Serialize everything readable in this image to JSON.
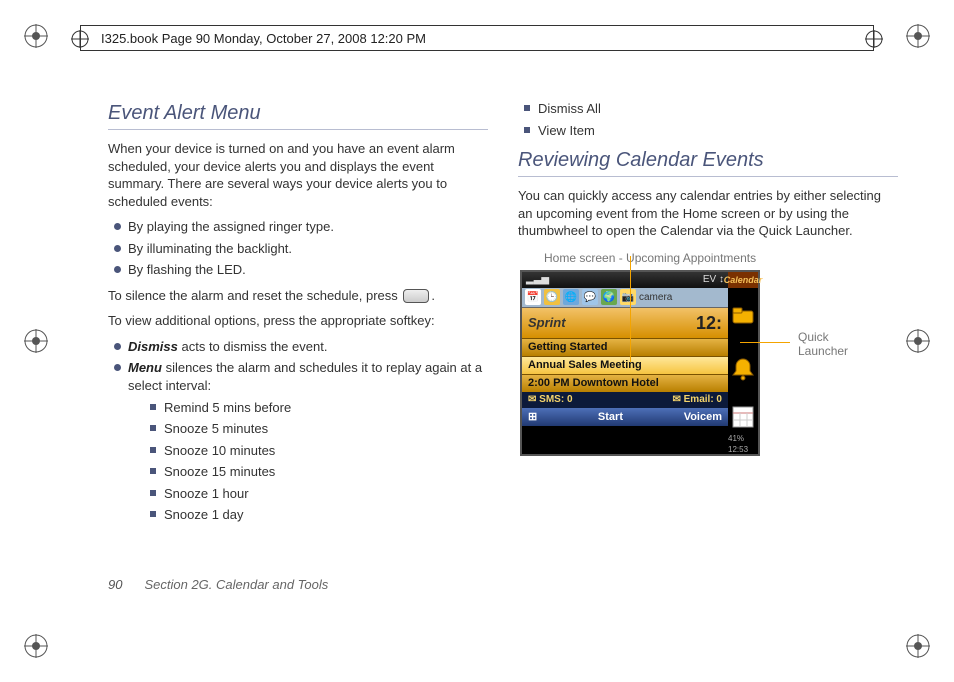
{
  "header": {
    "running": "I325.book  Page 90  Monday, October 27, 2008  12:20 PM"
  },
  "footer": {
    "pagenum": "90",
    "section": "Section 2G. Calendar and Tools"
  },
  "left": {
    "h1": "Event Alert Menu",
    "p1": "When your device is turned on and you have an event alarm scheduled, your device alerts you and displays the event summary. There are several ways your device alerts you to scheduled events:",
    "b1": "By playing the assigned ringer type.",
    "b2": "By illuminating the backlight.",
    "b3": "By flashing the LED.",
    "p2a": "To silence the alarm and reset the schedule, press ",
    "p2b": ".",
    "p3": "To view additional options, press the appropriate softkey:",
    "d_label": "Dismiss",
    "d_text": " acts to dismiss the event.",
    "m_label": "Menu",
    "m_text": " silences the alarm and schedules it to replay again at a select interval:",
    "s1": "Remind 5 mins before",
    "s2": "Snooze 5 minutes",
    "s3": "Snooze 10 minutes",
    "s4": "Snooze 15 minutes",
    "s5": "Snooze 1 hour",
    "s6": "Snooze 1 day"
  },
  "right": {
    "cb1": "Dismiss All",
    "cb2": "View Item",
    "h2": "Reviewing Calendar Events",
    "p1": "You can quickly access any calendar entries by either selecting an upcoming event from the Home screen or by using the thumbwheel to open the Calendar via the Quick Launcher.",
    "annot_top": "Home screen - Upcoming Appointments",
    "annot_side": "Quick Launcher"
  },
  "device": {
    "signal": "▂▃▅",
    "ev": "EV ↕",
    "camera_label": "camera",
    "carrier": "Sprint",
    "time_big": "12:",
    "row1": "Getting Started",
    "row2": "Annual Sales Meeting",
    "row3": "2:00 PM Downtown Hotel",
    "sms": "SMS: 0",
    "email": "Email: 0",
    "soft_left": "Start",
    "soft_right": "Voicem",
    "side_label": "Calendar",
    "batt": "41%  12:53",
    "envelope": "✉",
    "winkey": "⊞"
  }
}
